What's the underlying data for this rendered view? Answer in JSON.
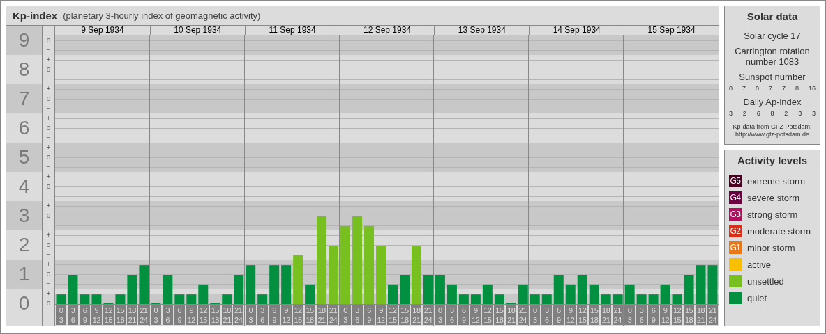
{
  "header": {
    "title": "Kp-index",
    "subtitle": "(planetary 3-hourly index of geomagnetic activity)"
  },
  "kp_chart": {
    "days": [
      "9 Sep 1934",
      "10 Sep 1934",
      "11 Sep 1934",
      "12 Sep 1934",
      "13 Sep 1934",
      "14 Sep 1934",
      "15 Sep 1934"
    ],
    "level_marks": [
      "o",
      "−",
      "+",
      "o",
      "−",
      "+",
      "o",
      "−",
      "+",
      "o",
      "−",
      "+",
      "o",
      "−",
      "+",
      "o",
      "−",
      "+",
      "o",
      "−",
      "+",
      "o",
      "−",
      "+",
      "o",
      "−",
      "+",
      "o"
    ],
    "chart_data": {
      "type": "bar",
      "grid": true,
      "ylim": [
        0,
        9
      ],
      "yticks": [
        0,
        1,
        2,
        3,
        4,
        5,
        6,
        7,
        8,
        9
      ],
      "categories": [
        "0 3",
        "3 6",
        "6 9",
        "9 12",
        "12 15",
        "15 18",
        "18 21",
        "21 24",
        "0 3",
        "3 6",
        "6 9",
        "9 12",
        "12 15",
        "15 18",
        "18 21",
        "21 24",
        "0 3",
        "3 6",
        "6 9",
        "9 12",
        "12 15",
        "15 18",
        "18 21",
        "21 24",
        "0 3",
        "3 6",
        "6 9",
        "9 12",
        "12 15",
        "15 18",
        "18 21",
        "21 24",
        "0 3",
        "3 6",
        "6 9",
        "9 12",
        "12 15",
        "15 18",
        "18 21",
        "21 24",
        "0 3",
        "3 6",
        "6 9",
        "9 12",
        "12 15",
        "15 18",
        "18 21",
        "21 24",
        "0 3",
        "3 6",
        "6 9",
        "9 12",
        "12 15",
        "15 18",
        "18 21",
        "21 24"
      ],
      "series": [
        {
          "color": "#009040",
          "values": [
            0.33,
            1,
            0.33,
            0.33,
            0,
            0.33,
            1,
            1.33,
            0,
            1,
            0.33,
            0.33,
            0.67,
            0,
            0.33,
            1,
            1.33,
            0.33,
            1.33,
            1.33,
            null,
            0.67,
            null,
            null,
            null,
            null,
            null,
            null,
            0.67,
            1,
            null,
            1,
            1,
            0.67,
            0.33,
            0.33,
            0.67,
            0.33,
            0,
            0.67,
            0.33,
            0.33,
            1,
            0.67,
            1,
            0.67,
            0.33,
            0.33,
            0.67,
            0.33,
            0.33,
            0.67,
            0.33,
            1,
            1.33,
            1.33
          ]
        },
        {
          "color": "#78c020",
          "values": [
            null,
            null,
            null,
            null,
            null,
            null,
            null,
            null,
            null,
            null,
            null,
            null,
            null,
            null,
            null,
            null,
            null,
            null,
            null,
            null,
            1.67,
            null,
            3,
            2,
            2.67,
            3,
            2.67,
            2,
            null,
            null,
            2,
            null,
            null,
            null,
            null,
            null,
            null,
            null,
            null,
            null,
            null,
            null,
            null,
            null,
            null,
            null,
            null,
            null,
            null,
            null,
            null,
            null,
            null,
            null,
            null,
            null
          ]
        }
      ]
    }
  },
  "solar_data": {
    "title": "Solar data",
    "solar_cycle": "Solar cycle 17",
    "carrington": "Carrington rotation number 1083",
    "sunspot_label": "Sunspot number",
    "sunspot_numbers": [
      "0",
      "7",
      "0",
      "7",
      "7",
      "8",
      "16"
    ],
    "ap_label": "Daily Ap-index",
    "ap_values": [
      "3",
      "2",
      "6",
      "8",
      "2",
      "3",
      "3"
    ],
    "source": "Kp-data from GFZ Potsdam:",
    "source_url": "http://www.gfz-potsdam.de"
  },
  "activity_levels": {
    "title": "Activity levels",
    "items": [
      {
        "badge": "G5",
        "label": "extreme storm",
        "color": "#4a0020"
      },
      {
        "badge": "G4",
        "label": "severe storm",
        "color": "#6a0040"
      },
      {
        "badge": "G3",
        "label": "strong storm",
        "color": "#b0105e"
      },
      {
        "badge": "G2",
        "label": "moderate storm",
        "color": "#d83018"
      },
      {
        "badge": "G1",
        "label": "minor storm",
        "color": "#e87818"
      },
      {
        "label": "active",
        "color": "#f8c000"
      },
      {
        "label": "unsettled",
        "color": "#78c020"
      },
      {
        "label": "quiet",
        "color": "#009040"
      }
    ]
  }
}
